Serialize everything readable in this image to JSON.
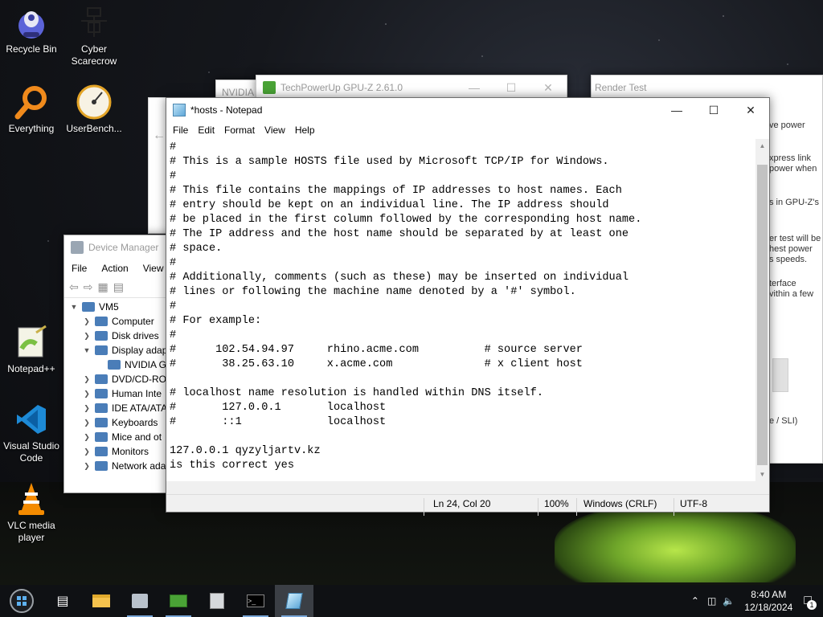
{
  "desktop": {
    "icons": [
      {
        "label": "Recycle Bin"
      },
      {
        "label": "Cyber Scarecrow"
      },
      {
        "label": "Everything"
      },
      {
        "label": "UserBench..."
      },
      {
        "label": "Notepad++"
      },
      {
        "label": "Visual Studio Code"
      },
      {
        "label": "VLC media player"
      }
    ]
  },
  "gpuz": {
    "title": "TechPowerUp GPU-Z 2.61.0",
    "tab": "NVIDIA"
  },
  "render_test": {
    "title": "Render Test",
    "snippets": [
      "ve power",
      "xpress link",
      "power when",
      "s in GPU-Z's",
      "er test will be",
      "hest power",
      "s speeds.",
      "terface",
      "vithin a few",
      "e / SLI)"
    ]
  },
  "notepad": {
    "title": "*hosts - Notepad",
    "menu": [
      "File",
      "Edit",
      "Format",
      "View",
      "Help"
    ],
    "content": "#\n# This is a sample HOSTS file used by Microsoft TCP/IP for Windows.\n#\n# This file contains the mappings of IP addresses to host names. Each\n# entry should be kept on an individual line. The IP address should\n# be placed in the first column followed by the corresponding host name.\n# The IP address and the host name should be separated by at least one\n# space.\n#\n# Additionally, comments (such as these) may be inserted on individual\n# lines or following the machine name denoted by a '#' symbol.\n#\n# For example:\n#\n#      102.54.94.97     rhino.acme.com          # source server\n#       38.25.63.10     x.acme.com              # x client host\n\n# localhost name resolution is handled within DNS itself.\n#\t127.0.0.1       localhost\n#\t::1             localhost\n\n127.0.0.1 qyzyljartv.kz\nis this correct yes",
    "status": {
      "position": "Ln 24, Col 20",
      "zoom": "100%",
      "line_ending": "Windows (CRLF)",
      "encoding": "UTF-8"
    }
  },
  "device_manager": {
    "title": "Device Manager",
    "menu": [
      "File",
      "Action",
      "View"
    ],
    "tree": [
      {
        "label": "VM5",
        "level": 0,
        "expanded": true
      },
      {
        "label": "Computer",
        "level": 1,
        "expanded": false
      },
      {
        "label": "Disk drives",
        "level": 1,
        "expanded": false
      },
      {
        "label": "Display adap",
        "level": 1,
        "expanded": true
      },
      {
        "label": "NVIDIA G",
        "level": 2,
        "expanded": null
      },
      {
        "label": "DVD/CD-RO",
        "level": 1,
        "expanded": false
      },
      {
        "label": "Human Inte",
        "level": 1,
        "expanded": false
      },
      {
        "label": "IDE ATA/ATA",
        "level": 1,
        "expanded": false
      },
      {
        "label": "Keyboards",
        "level": 1,
        "expanded": false
      },
      {
        "label": "Mice and ot",
        "level": 1,
        "expanded": false
      },
      {
        "label": "Monitors",
        "level": 1,
        "expanded": false
      },
      {
        "label": "Network ada",
        "level": 1,
        "expanded": false
      }
    ]
  },
  "taskbar": {
    "apps": [
      {
        "icon": "task-view-icon"
      },
      {
        "icon": "file-explorer-icon"
      },
      {
        "icon": "device-manager-icon"
      },
      {
        "icon": "gpuz-icon"
      },
      {
        "icon": "installer-icon"
      },
      {
        "icon": "terminal-icon"
      },
      {
        "icon": "notepad-icon"
      }
    ],
    "time": "8:40 AM",
    "date": "12/18/2024",
    "notification_count": "1"
  }
}
